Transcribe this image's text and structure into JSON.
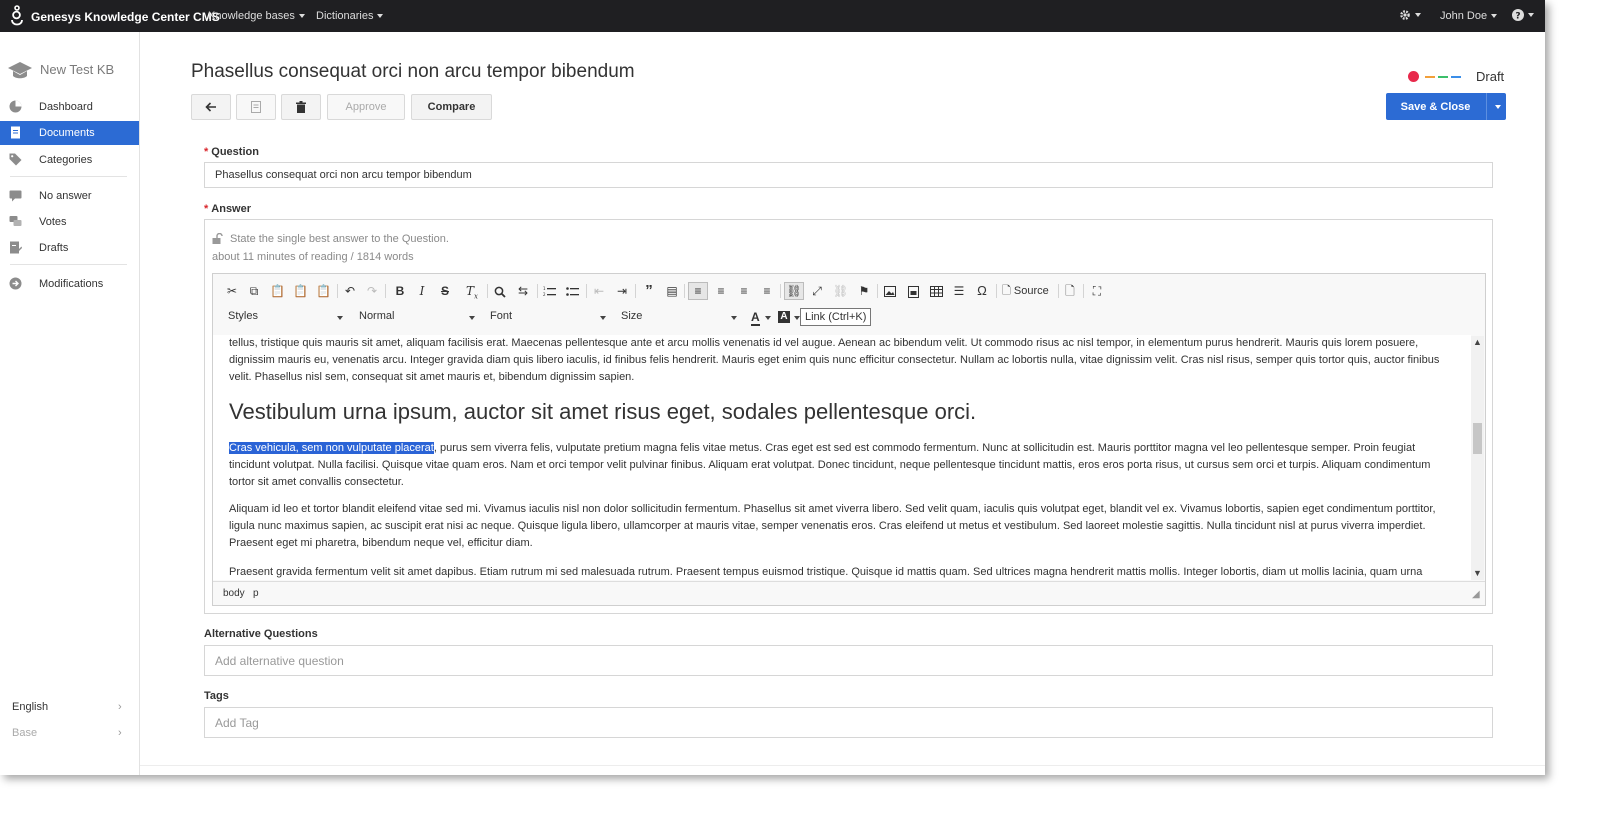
{
  "topbar": {
    "brand": "Genesys Knowledge Center CMS",
    "nav": [
      "Knowledge bases",
      "Dictionaries"
    ],
    "settings_icon": "gear-icon",
    "user": "John Doe",
    "help_icon": "help-icon"
  },
  "sidebar": {
    "kb_name": "New Test KB",
    "items": [
      {
        "label": "Dashboard",
        "icon": "pie-chart-icon"
      },
      {
        "label": "Documents",
        "icon": "document-icon",
        "active": true
      },
      {
        "label": "Categories",
        "icon": "tag-icon"
      },
      {
        "label": "No answer",
        "icon": "chat-icon"
      },
      {
        "label": "Votes",
        "icon": "comments-icon"
      },
      {
        "label": "Drafts",
        "icon": "draft-icon"
      },
      {
        "label": "Modifications",
        "icon": "arrow-circle-icon"
      }
    ],
    "language": "English",
    "base": "Base"
  },
  "document": {
    "title": "Phasellus consequat orci non arcu tempor bibendum",
    "status": "Draft",
    "status_colors": [
      "#e8294b",
      "#f2a03a",
      "#3cbf6a",
      "#3b8ee8"
    ],
    "buttons": {
      "approve": "Approve",
      "compare": "Compare",
      "save_close": "Save & Close"
    }
  },
  "question": {
    "label": "Question",
    "value": "Phasellus consequat orci non arcu tempor bibendum"
  },
  "answer": {
    "label": "Answer",
    "hint": "State the single best answer to the Question.",
    "reading": "about 11 minutes of reading / 1814 words",
    "combos": {
      "styles": "Styles",
      "format": "Normal",
      "font": "Font",
      "size": "Size"
    },
    "source_label": "Source",
    "tooltip": "Link (Ctrl+K)",
    "paragraph1": "tellus, tristique quis mauris sit amet, aliquam facilisis erat. Maecenas pellentesque ante et arcu mollis venenatis id vel augue. Aenean ac bibendum velit. Ut commodo risus ac nisl tempor, in elementum purus hendrerit. Mauris quis lorem posuere, dignissim mauris eu, venenatis arcu. Integer gravida diam quis libero iaculis, id finibus felis hendrerit. Mauris eget enim quis nunc efficitur consectetur. Nullam ac lobortis nulla, vitae dignissim velit. Cras nisl risus, semper quis tortor quis, auctor finibus velit. Phasellus nisl sem, consequat sit amet mauris et, bibendum dignissim sapien.",
    "heading": "Vestibulum urna ipsum, auctor sit amet risus eget, sodales pellentesque orci.",
    "selected": "Cras vehicula, sem non vulputate placerat",
    "paragraph2": ", purus sem viverra felis, vulputate pretium magna felis vitae metus. Cras eget est sed est commodo fermentum. Nunc at sollicitudin est. Mauris porttitor magna vel leo pellentesque semper. Proin feugiat tincidunt volutpat. Nulla facilisi. Quisque vitae quam eros. Nam et orci tempor velit pulvinar finibus. Aliquam erat volutpat. Donec tincidunt, neque pellentesque tincidunt mattis, eros eros porta risus, ut cursus sem orci et turpis. Aliquam condimentum tortor sit amet convallis consectetur.",
    "paragraph3": "Aliquam id leo et tortor blandit eleifend vitae sed mi. Vivamus iaculis nisl non dolor sollicitudin fermentum. Phasellus sit amet viverra libero. Sed velit quam, iaculis quis volutpat eget, blandit vel ex. Vivamus lobortis, sapien eget condimentum porttitor, ligula nunc maximus sapien, ac suscipit erat nisi ac neque. Quisque ligula libero, ullamcorper at mauris vitae, semper venenatis eros. Cras eleifend ut metus et vestibulum. Sed laoreet molestie sagittis. Nulla tincidunt nisl at purus viverra imperdiet. Praesent eget mi pharetra, bibendum neque vel, efficitur diam.",
    "paragraph4": "Praesent gravida fermentum velit sit amet dapibus. Etiam rutrum mi sed malesuada rutrum. Praesent tempus euismod tristique. Quisque id mattis quam. Sed ultrices magna hendrerit mattis mollis. Integer lobortis, diam ut mollis lacinia, quam urna faucibus",
    "path": [
      "body",
      "p"
    ]
  },
  "alternative_questions": {
    "label": "Alternative Questions",
    "placeholder": "Add alternative question"
  },
  "tags": {
    "label": "Tags",
    "placeholder": "Add Tag"
  }
}
